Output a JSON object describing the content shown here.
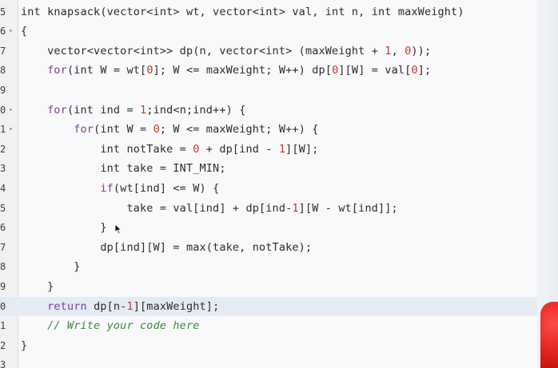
{
  "editor": {
    "lines": [
      {
        "number": "5",
        "fold": "",
        "text": "int knapsack(vector<int> wt, vector<int> val, int n, int maxWeight)"
      },
      {
        "number": "6",
        "fold": "▾",
        "text": "{"
      },
      {
        "number": "7",
        "fold": "",
        "text": "    vector<vector<int>> dp(n, vector<int> (maxWeight + 1, 0));"
      },
      {
        "number": "8",
        "fold": "",
        "text": "    for(int W = wt[0]; W <= maxWeight; W++) dp[0][W] = val[0];"
      },
      {
        "number": "9",
        "fold": "",
        "text": ""
      },
      {
        "number": "0",
        "fold": "▾",
        "text": "    for(int ind = 1;ind<n;ind++) {"
      },
      {
        "number": "1",
        "fold": "▾",
        "text": "        for(int W = 0; W <= maxWeight; W++) {"
      },
      {
        "number": "2",
        "fold": "",
        "text": "            int notTake = 0 + dp[ind - 1][W];"
      },
      {
        "number": "3",
        "fold": "",
        "text": "            int take = INT_MIN;"
      },
      {
        "number": "4",
        "fold": "",
        "text": "            if(wt[ind] <= W) {"
      },
      {
        "number": "5",
        "fold": "",
        "text": "                take = val[ind] + dp[ind-1][W - wt[ind]];"
      },
      {
        "number": "6",
        "fold": "",
        "text": "            }"
      },
      {
        "number": "7",
        "fold": "",
        "text": "            dp[ind][W] = max(take, notTake);"
      },
      {
        "number": "8",
        "fold": "",
        "text": "        }"
      },
      {
        "number": "9",
        "fold": "",
        "text": "    }"
      },
      {
        "number": "0",
        "fold": "",
        "text": "    return dp[n-1][maxWeight];"
      },
      {
        "number": "1",
        "fold": "",
        "text": "    // Write your code here"
      },
      {
        "number": "2",
        "fold": "",
        "text": "}"
      },
      {
        "number": "3",
        "fold": "",
        "text": ""
      }
    ],
    "active_line_index": 15,
    "colors": {
      "keyword": "#7a3e9d",
      "type": "#1d5fa8",
      "number": "#c0392b",
      "comment": "#3a8a3a",
      "active_line_bg": "#e4ebf3"
    }
  },
  "icons": {
    "fold_marker": "chevron-down-icon",
    "pointer": "mouse-cursor-icon"
  }
}
